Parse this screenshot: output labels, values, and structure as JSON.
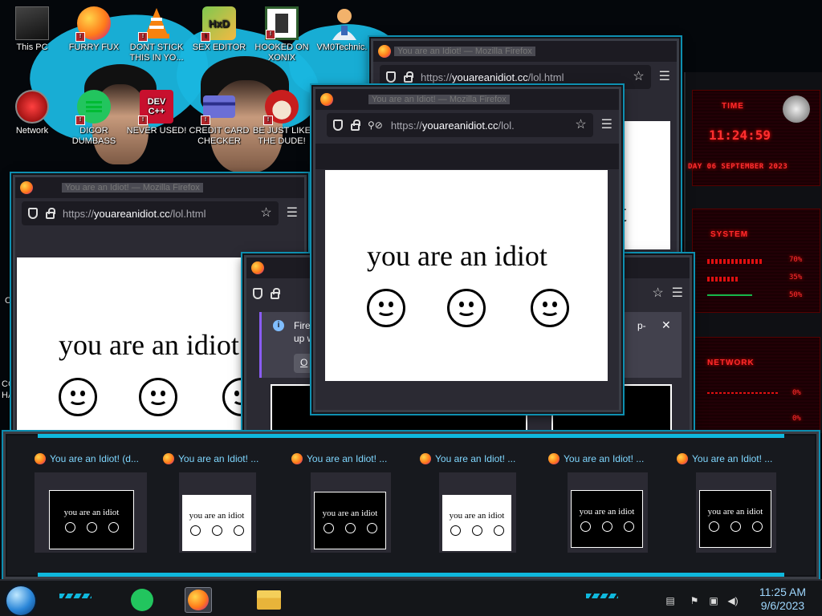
{
  "desktop_icons": [
    {
      "label": "This PC",
      "icon": "computer-icon"
    },
    {
      "label": "FURRY FUX",
      "icon": "firefox-icon"
    },
    {
      "label": "DONT STICK THIS IN YO...",
      "icon": "vlc-icon"
    },
    {
      "label": "SEX EDITOR",
      "icon": "hxd-editor-icon"
    },
    {
      "label": "HOOKED ON XONIX",
      "icon": "xonix-game-icon"
    },
    {
      "label": "VM0Technic...",
      "icon": "technician-icon"
    },
    {
      "label": "Network",
      "icon": "network-icon"
    },
    {
      "label": "DICOR DUMBASS",
      "icon": "green-chat-icon"
    },
    {
      "label": "NEVER USED!",
      "icon": "devcpp-icon"
    },
    {
      "label": "CREDIT CARD CHECKER",
      "icon": "credit-card-icon"
    },
    {
      "label": "BE JUST LIKE THE DUDE!",
      "icon": "santa-icon"
    }
  ],
  "desktop_partial_labels": [
    "F",
    "Co",
    "CC",
    "HA"
  ],
  "firefox": {
    "window_title": "You are an Idiot! — Mozilla Firefox",
    "url_prefix": "https://",
    "url_host": "youareanidiot.cc",
    "url_path": "/lol.html",
    "url_path_short": "/lol.",
    "page_text": "you are an idiot",
    "popup_notice_1": "Firef",
    "popup_notice_2": "up w",
    "popup_notice_button": "O",
    "popup_notice_tail": "p-",
    "partial_text": "t"
  },
  "gadget": {
    "time_label": "TIME",
    "time_value": "11:24:59",
    "date_value": "DAY 06 SEPTEMBER 2023",
    "system_label": "SYSTEM",
    "system_values": [
      "70%",
      "35%",
      "50%"
    ],
    "network_label": "NETWORK",
    "network_values": [
      "0%",
      "0%"
    ]
  },
  "switcher": {
    "items": [
      {
        "title": "You are an Idiot! (d...",
        "theme": "dark",
        "page_text": "you are an idiot"
      },
      {
        "title": "You are an Idiot! ...",
        "theme": "light",
        "page_text": "you are an idiot"
      },
      {
        "title": "You are an Idiot! ...",
        "theme": "dark",
        "page_text": "you are an idiot"
      },
      {
        "title": "You are an Idiot! ...",
        "theme": "light",
        "page_text": "you are an idiot"
      },
      {
        "title": "You are an Idiot! ...",
        "theme": "dark",
        "page_text": "you are an idiot"
      },
      {
        "title": "You are an Idiot! ...",
        "theme": "dark",
        "page_text": "you are an idiot"
      }
    ]
  },
  "taskbar": {
    "pinned": [
      "green-chat-icon",
      "firefox-icon",
      "file-explorer-icon"
    ],
    "tray_icons": [
      "action-center-icon",
      "flag-icon",
      "network-icon",
      "volume-icon"
    ],
    "time": "11:25 AM",
    "date": "9/6/2023"
  },
  "colors": {
    "accent_cyan": "#0fb8dd",
    "gadget_red": "#ff2b2b",
    "firefox_chrome": "#2b2a33"
  }
}
